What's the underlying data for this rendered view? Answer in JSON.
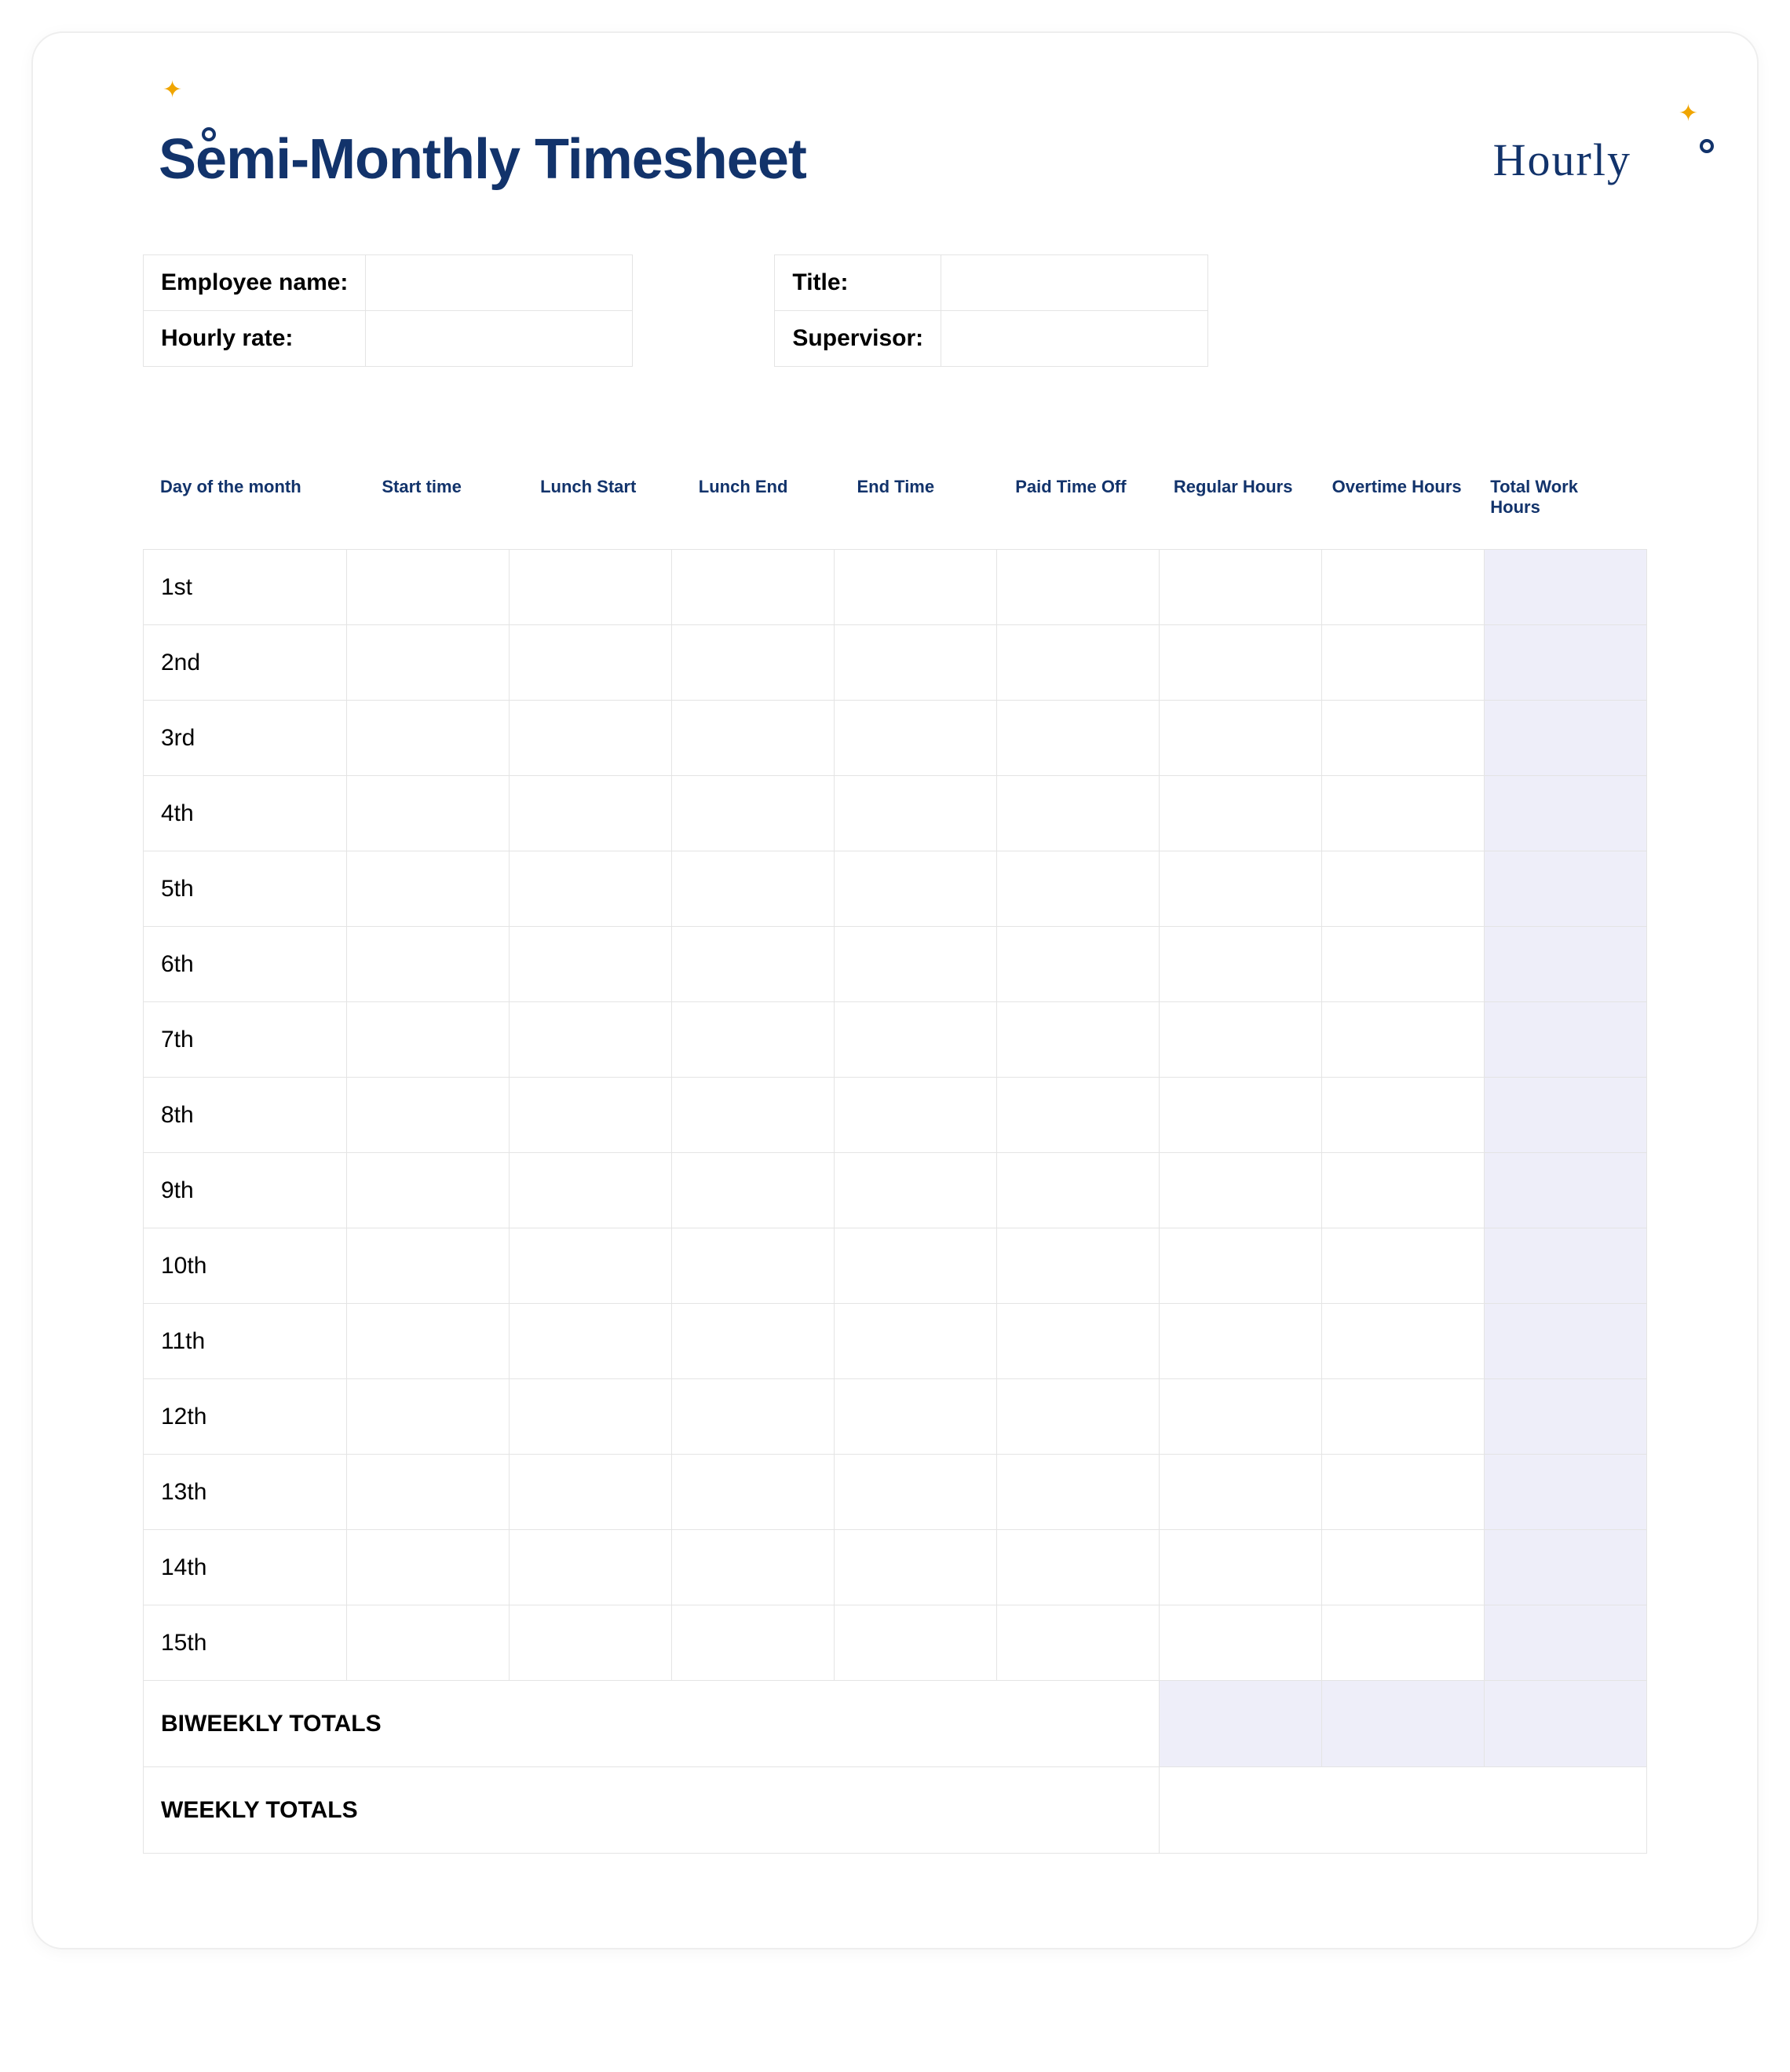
{
  "brand": "Hourly",
  "title": "Semi-Monthly Timesheet",
  "info": {
    "left": [
      {
        "label": "Employee name:",
        "value": ""
      },
      {
        "label": "Hourly rate:",
        "value": ""
      }
    ],
    "right": [
      {
        "label": "Title:",
        "value": ""
      },
      {
        "label": "Supervisor:",
        "value": ""
      }
    ]
  },
  "columns": [
    "Day of the month",
    "Start time",
    "Lunch Start",
    "Lunch End",
    "End Time",
    "Paid Time Off",
    "Regular Hours",
    "Overtime Hours",
    "Total Work Hours"
  ],
  "days": [
    "1st",
    "2nd",
    "3rd",
    "4th",
    "5th",
    "6th",
    "7th",
    "8th",
    "9th",
    "10th",
    "11th",
    "12th",
    "13th",
    "14th",
    "15th"
  ],
  "totals": {
    "biweekly_label": "BIWEEKLY TOTALS",
    "weekly_label": "WEEKLY TOTALS"
  }
}
